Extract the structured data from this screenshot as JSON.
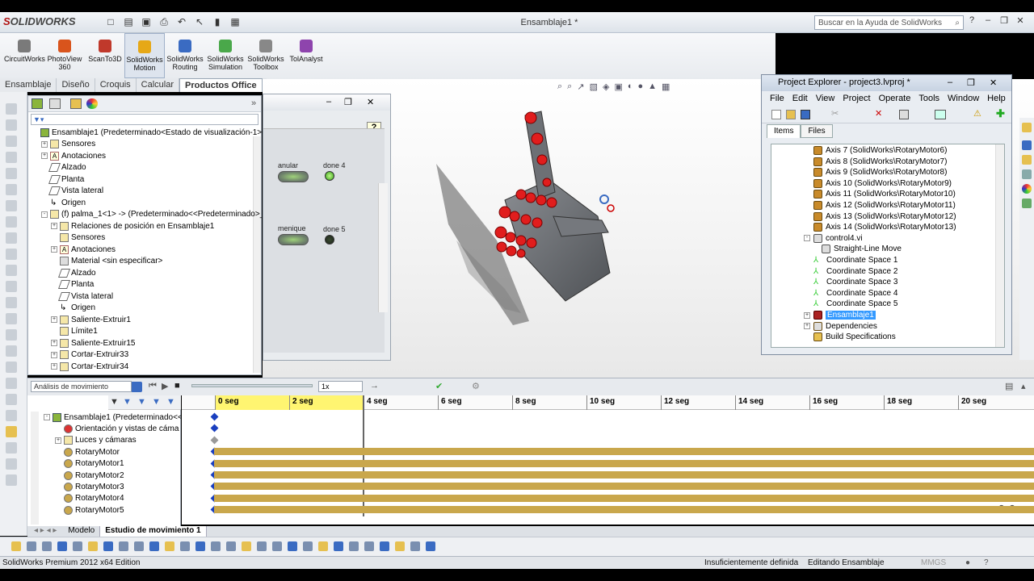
{
  "app": {
    "brand_a": "S",
    "brand_b": "OLIDWORKS",
    "document_title": "Ensamblaje1 *"
  },
  "help_search": {
    "placeholder": "Buscar en la Ayuda de SolidWorks"
  },
  "command_manager": {
    "items": [
      {
        "label": "CircuitWorks",
        "color": "#7a7a7a"
      },
      {
        "label": "PhotoView 360",
        "color": "#d9541c"
      },
      {
        "label": "ScanTo3D",
        "color": "#c0392b"
      },
      {
        "label": "SolidWorks Motion",
        "color": "#e6a817",
        "active": true
      },
      {
        "label": "SolidWorks Routing",
        "color": "#3a6bc2"
      },
      {
        "label": "SolidWorks Simulation",
        "color": "#4aa84a"
      },
      {
        "label": "SolidWorks Toolbox",
        "color": "#888888"
      },
      {
        "label": "TolAnalyst",
        "color": "#8e44ad"
      }
    ],
    "tabs": [
      "Ensamblaje",
      "Diseño",
      "Croquis",
      "Calcular",
      "Productos Office"
    ]
  },
  "feature_tree": {
    "rows": [
      {
        "text": "Ensamblaje1  (Predeterminado<Estado de visualización-1>)",
        "indent": 0,
        "icon": "asm"
      },
      {
        "text": "Sensores",
        "indent": 1,
        "icon": "folder",
        "exp": "+"
      },
      {
        "text": "Anotaciones",
        "indent": 1,
        "icon": "ann",
        "exp": "+"
      },
      {
        "text": "Alzado",
        "indent": 1,
        "icon": "plane"
      },
      {
        "text": "Planta",
        "indent": 1,
        "icon": "plane"
      },
      {
        "text": "Vista lateral",
        "indent": 1,
        "icon": "plane"
      },
      {
        "text": "Origen",
        "indent": 1,
        "icon": "origin"
      },
      {
        "text": "(f) palma_1<1> -> (Predeterminado<<Predeterminado>_",
        "indent": 1,
        "icon": "folder",
        "exp": "-"
      },
      {
        "text": "Relaciones de posición en Ensamblaje1",
        "indent": 2,
        "icon": "folder",
        "exp": "+"
      },
      {
        "text": "Sensores",
        "indent": 2,
        "icon": "folder"
      },
      {
        "text": "Anotaciones",
        "indent": 2,
        "icon": "ann",
        "exp": "+"
      },
      {
        "text": "Material <sin especificar>",
        "indent": 2,
        "icon": "mat"
      },
      {
        "text": "Alzado",
        "indent": 2,
        "icon": "plane"
      },
      {
        "text": "Planta",
        "indent": 2,
        "icon": "plane"
      },
      {
        "text": "Vista lateral",
        "indent": 2,
        "icon": "plane"
      },
      {
        "text": "Origen",
        "indent": 2,
        "icon": "origin"
      },
      {
        "text": "Saliente-Extruir1",
        "indent": 2,
        "icon": "folder",
        "exp": "+"
      },
      {
        "text": "Límite1",
        "indent": 2,
        "icon": "folder"
      },
      {
        "text": "Saliente-Extruir15",
        "indent": 2,
        "icon": "folder",
        "exp": "+"
      },
      {
        "text": "Cortar-Extruir33",
        "indent": 2,
        "icon": "folder",
        "exp": "+"
      },
      {
        "text": "Cortar-Extruir34",
        "indent": 2,
        "icon": "folder",
        "exp": "+"
      }
    ]
  },
  "front_panel": {
    "buttons": [
      {
        "label": "anular"
      },
      {
        "label": "menique"
      }
    ],
    "leds": [
      {
        "label": "done 4",
        "state": "on"
      },
      {
        "label": "done 5",
        "state": "off"
      }
    ],
    "help": "?"
  },
  "project_explorer": {
    "title": "Project Explorer - project3.lvproj *",
    "menu": [
      "File",
      "Edit",
      "View",
      "Project",
      "Operate",
      "Tools",
      "Window",
      "Help"
    ],
    "tabs": [
      "Items",
      "Files"
    ],
    "rows": [
      {
        "text": "Axis 7 (SolidWorks\\RotaryMotor6)",
        "indent": 2,
        "icon": "axis"
      },
      {
        "text": "Axis 8 (SolidWorks\\RotaryMotor7)",
        "indent": 2,
        "icon": "axis"
      },
      {
        "text": "Axis 9 (SolidWorks\\RotaryMotor8)",
        "indent": 2,
        "icon": "axis"
      },
      {
        "text": "Axis 10 (SolidWorks\\RotaryMotor9)",
        "indent": 2,
        "icon": "axis"
      },
      {
        "text": "Axis 11 (SolidWorks\\RotaryMotor10)",
        "indent": 2,
        "icon": "axis"
      },
      {
        "text": "Axis 12 (SolidWorks\\RotaryMotor11)",
        "indent": 2,
        "icon": "axis"
      },
      {
        "text": "Axis 13 (SolidWorks\\RotaryMotor12)",
        "indent": 2,
        "icon": "axis"
      },
      {
        "text": "Axis 14 (SolidWorks\\RotaryMotor13)",
        "indent": 2,
        "icon": "axis"
      },
      {
        "text": "control4.vi",
        "indent": 2,
        "icon": "vi",
        "exp": "-"
      },
      {
        "text": "Straight-Line Move",
        "indent": 3,
        "icon": "vi"
      },
      {
        "text": "Coordinate Space 1",
        "indent": 2,
        "icon": "cs"
      },
      {
        "text": "Coordinate Space 2",
        "indent": 2,
        "icon": "cs"
      },
      {
        "text": "Coordinate Space 3",
        "indent": 2,
        "icon": "cs"
      },
      {
        "text": "Coordinate Space 4",
        "indent": 2,
        "icon": "cs"
      },
      {
        "text": "Coordinate Space 5",
        "indent": 2,
        "icon": "cs"
      },
      {
        "text": "Ensamblaje1",
        "indent": 2,
        "icon": "sw",
        "exp": "+",
        "selected": true
      },
      {
        "text": "Dependencies",
        "indent": 2,
        "icon": "dep",
        "exp": "+"
      },
      {
        "text": "Build Specifications",
        "indent": 2,
        "icon": "build"
      }
    ]
  },
  "motion_manager": {
    "study_type": "Análisis de movimiento",
    "speed": "1x",
    "tree_rows": [
      {
        "text": "Ensamblaje1  (Predeterminado<<",
        "indent": 0,
        "icon": "asm",
        "exp": "-"
      },
      {
        "text": "Orientación y vistas de cáma",
        "indent": 1,
        "icon": "cam"
      },
      {
        "text": "Luces y cámaras",
        "indent": 1,
        "icon": "folder",
        "exp": "+"
      },
      {
        "text": "RotaryMotor",
        "indent": 1,
        "icon": "motor"
      },
      {
        "text": "RotaryMotor1",
        "indent": 1,
        "icon": "motor"
      },
      {
        "text": "RotaryMotor2",
        "indent": 1,
        "icon": "motor"
      },
      {
        "text": "RotaryMotor3",
        "indent": 1,
        "icon": "motor"
      },
      {
        "text": "RotaryMotor4",
        "indent": 1,
        "icon": "motor"
      },
      {
        "text": "RotaryMotor5",
        "indent": 1,
        "icon": "motor"
      }
    ],
    "ticks": [
      "0 seg",
      "2 seg",
      "4 seg",
      "6 seg",
      "8 seg",
      "10 seg",
      "12 seg",
      "14 seg",
      "16 seg",
      "18 seg",
      "20 seg"
    ],
    "tabs": [
      "Modelo",
      "Estudio de movimiento 1"
    ]
  },
  "status_bar": {
    "edition": "SolidWorks Premium 2012 x64 Edition",
    "state": "Insuficientemente definida",
    "editing": "Editando Ensamblaje",
    "units": "MMGS"
  }
}
